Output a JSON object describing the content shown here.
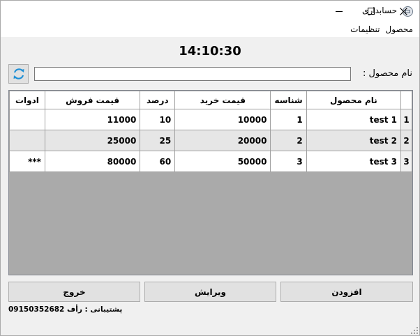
{
  "window": {
    "title": "حسابداری",
    "icon": "app-icon"
  },
  "menu": {
    "items": [
      "محصول",
      "تنظیمات"
    ]
  },
  "clock": "14:10:30",
  "search": {
    "label": "نام محصول :",
    "value": "",
    "refresh_icon": "refresh-icon"
  },
  "table": {
    "columns": [
      "نام محصول",
      "شناسه",
      "قیمت خرید",
      "درصد",
      "قیمت فروش",
      "ادوات"
    ],
    "rows": [
      {
        "header": "1",
        "name": "test 1",
        "id": "1",
        "buy": "10000",
        "percent": "10",
        "sell": "11000",
        "tools": ""
      },
      {
        "header": "2",
        "name": "test 2",
        "id": "2",
        "buy": "20000",
        "percent": "25",
        "sell": "25000",
        "tools": ""
      },
      {
        "header": "3",
        "name": "test 3",
        "id": "3",
        "buy": "50000",
        "percent": "60",
        "sell": "80000",
        "tools": "***"
      }
    ]
  },
  "buttons": {
    "add": "افزودن",
    "edit": "ویرایش",
    "exit": "خروج"
  },
  "support": "پشتیبانی : رأف 09150352682"
}
